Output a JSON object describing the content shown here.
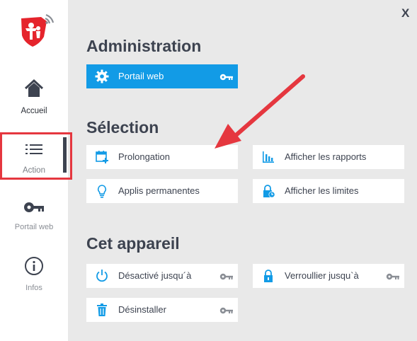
{
  "colors": {
    "accent_blue": "#129be6",
    "dark_text": "#3d4350",
    "annotation_red": "#e5373f",
    "panel_bg": "#e9e9e9",
    "brand_red": "#e5242c"
  },
  "sidebar": {
    "items": [
      {
        "label": "Accueil",
        "icon": "home-icon"
      },
      {
        "label": "Action",
        "icon": "list-icon",
        "active": true
      },
      {
        "label": "Portail web",
        "icon": "key-icon"
      },
      {
        "label": "Infos",
        "icon": "info-icon"
      }
    ]
  },
  "close_label": "X",
  "sections": {
    "admin": {
      "title": "Administration",
      "tiles": [
        {
          "label": "Portail web",
          "icon": "gear-icon",
          "locked": true
        }
      ]
    },
    "selection": {
      "title": "Sélection",
      "tiles": [
        {
          "label": "Prolongation",
          "icon": "calendar-plus-icon"
        },
        {
          "label": "Afficher les rapports",
          "icon": "bar-chart-icon"
        },
        {
          "label": "Applis permanentes",
          "icon": "lightbulb-icon"
        },
        {
          "label": "Afficher les limites",
          "icon": "lock-clock-icon"
        }
      ]
    },
    "device": {
      "title": "Cet appareil",
      "tiles": [
        {
          "label": "Désactivé jusqu´à",
          "icon": "power-icon",
          "locked": true
        },
        {
          "label": "Verroullier jusqu`à",
          "icon": "padlock-icon",
          "locked": true
        },
        {
          "label": "Désinstaller",
          "icon": "trash-icon",
          "locked": true
        }
      ]
    }
  }
}
